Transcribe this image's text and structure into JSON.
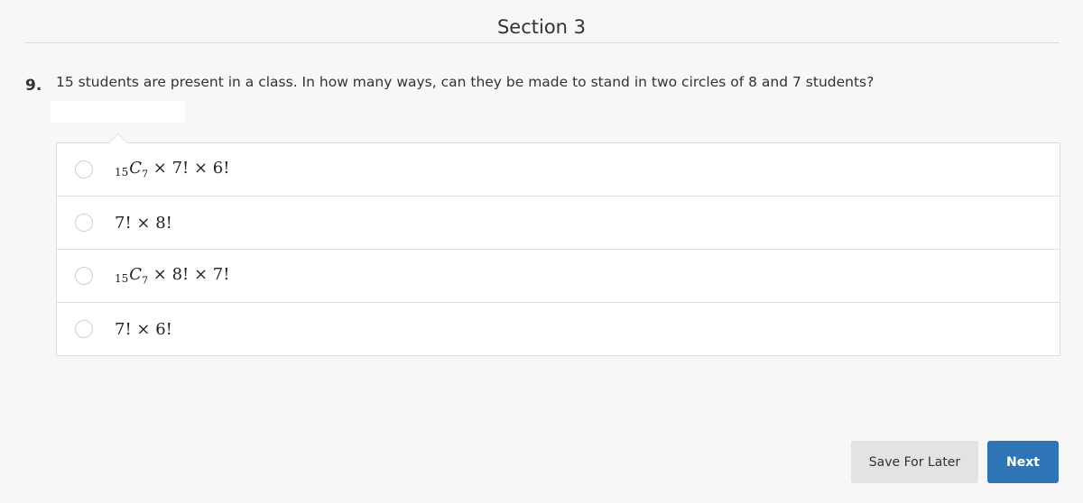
{
  "header": {
    "section_title": "Section 3"
  },
  "question": {
    "number": "9.",
    "text": "15 students are present in a class. In how many ways, can they be made to stand in two circles of 8 and 7 students?"
  },
  "options": [
    {
      "prefix_sub": "15",
      "symbol": "C",
      "symbol_sub": "7",
      "rest": " × 7! × 6!",
      "selected": false
    },
    {
      "prefix_sub": "",
      "symbol": "",
      "symbol_sub": "",
      "rest": "7! × 8!",
      "selected": false
    },
    {
      "prefix_sub": "15",
      "symbol": "C",
      "symbol_sub": "7",
      "rest": " × 8! × 7!",
      "selected": false
    },
    {
      "prefix_sub": "",
      "symbol": "",
      "symbol_sub": "",
      "rest": "7! × 6!",
      "selected": false
    }
  ],
  "actions": {
    "save_label": "Save For Later",
    "next_label": "Next"
  },
  "colors": {
    "primary": "#2f75b5",
    "secondary": "#e3e3e3"
  }
}
